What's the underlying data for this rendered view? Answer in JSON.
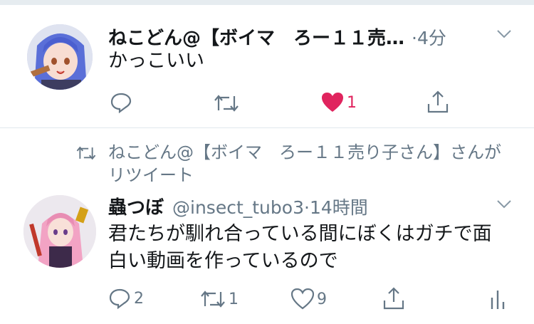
{
  "tweet1": {
    "display_name": "ねこどん@【ボイマ　ろー１１売…",
    "time": "4分",
    "text": "かっこいい",
    "actions": {
      "reply": "",
      "retweet": "",
      "like": "1",
      "share": ""
    },
    "colors": {
      "like": "#e0245e"
    }
  },
  "tweet2": {
    "retweet_context": "ねこどん@【ボイマ　ろー１１売り子さん】さんがリツイート",
    "display_name": "蟲つぼ",
    "handle": "@insect_tubo3",
    "time": "14時間",
    "text": "君たちが馴れ合っている間にぼくはガチで面白い動画を作っているので",
    "actions": {
      "reply": "2",
      "retweet": "1",
      "like": "9",
      "share": "",
      "analytics": ""
    }
  },
  "colors": {
    "secondary": "#657786",
    "divider": "#e1e8ed",
    "text": "#14171a"
  }
}
